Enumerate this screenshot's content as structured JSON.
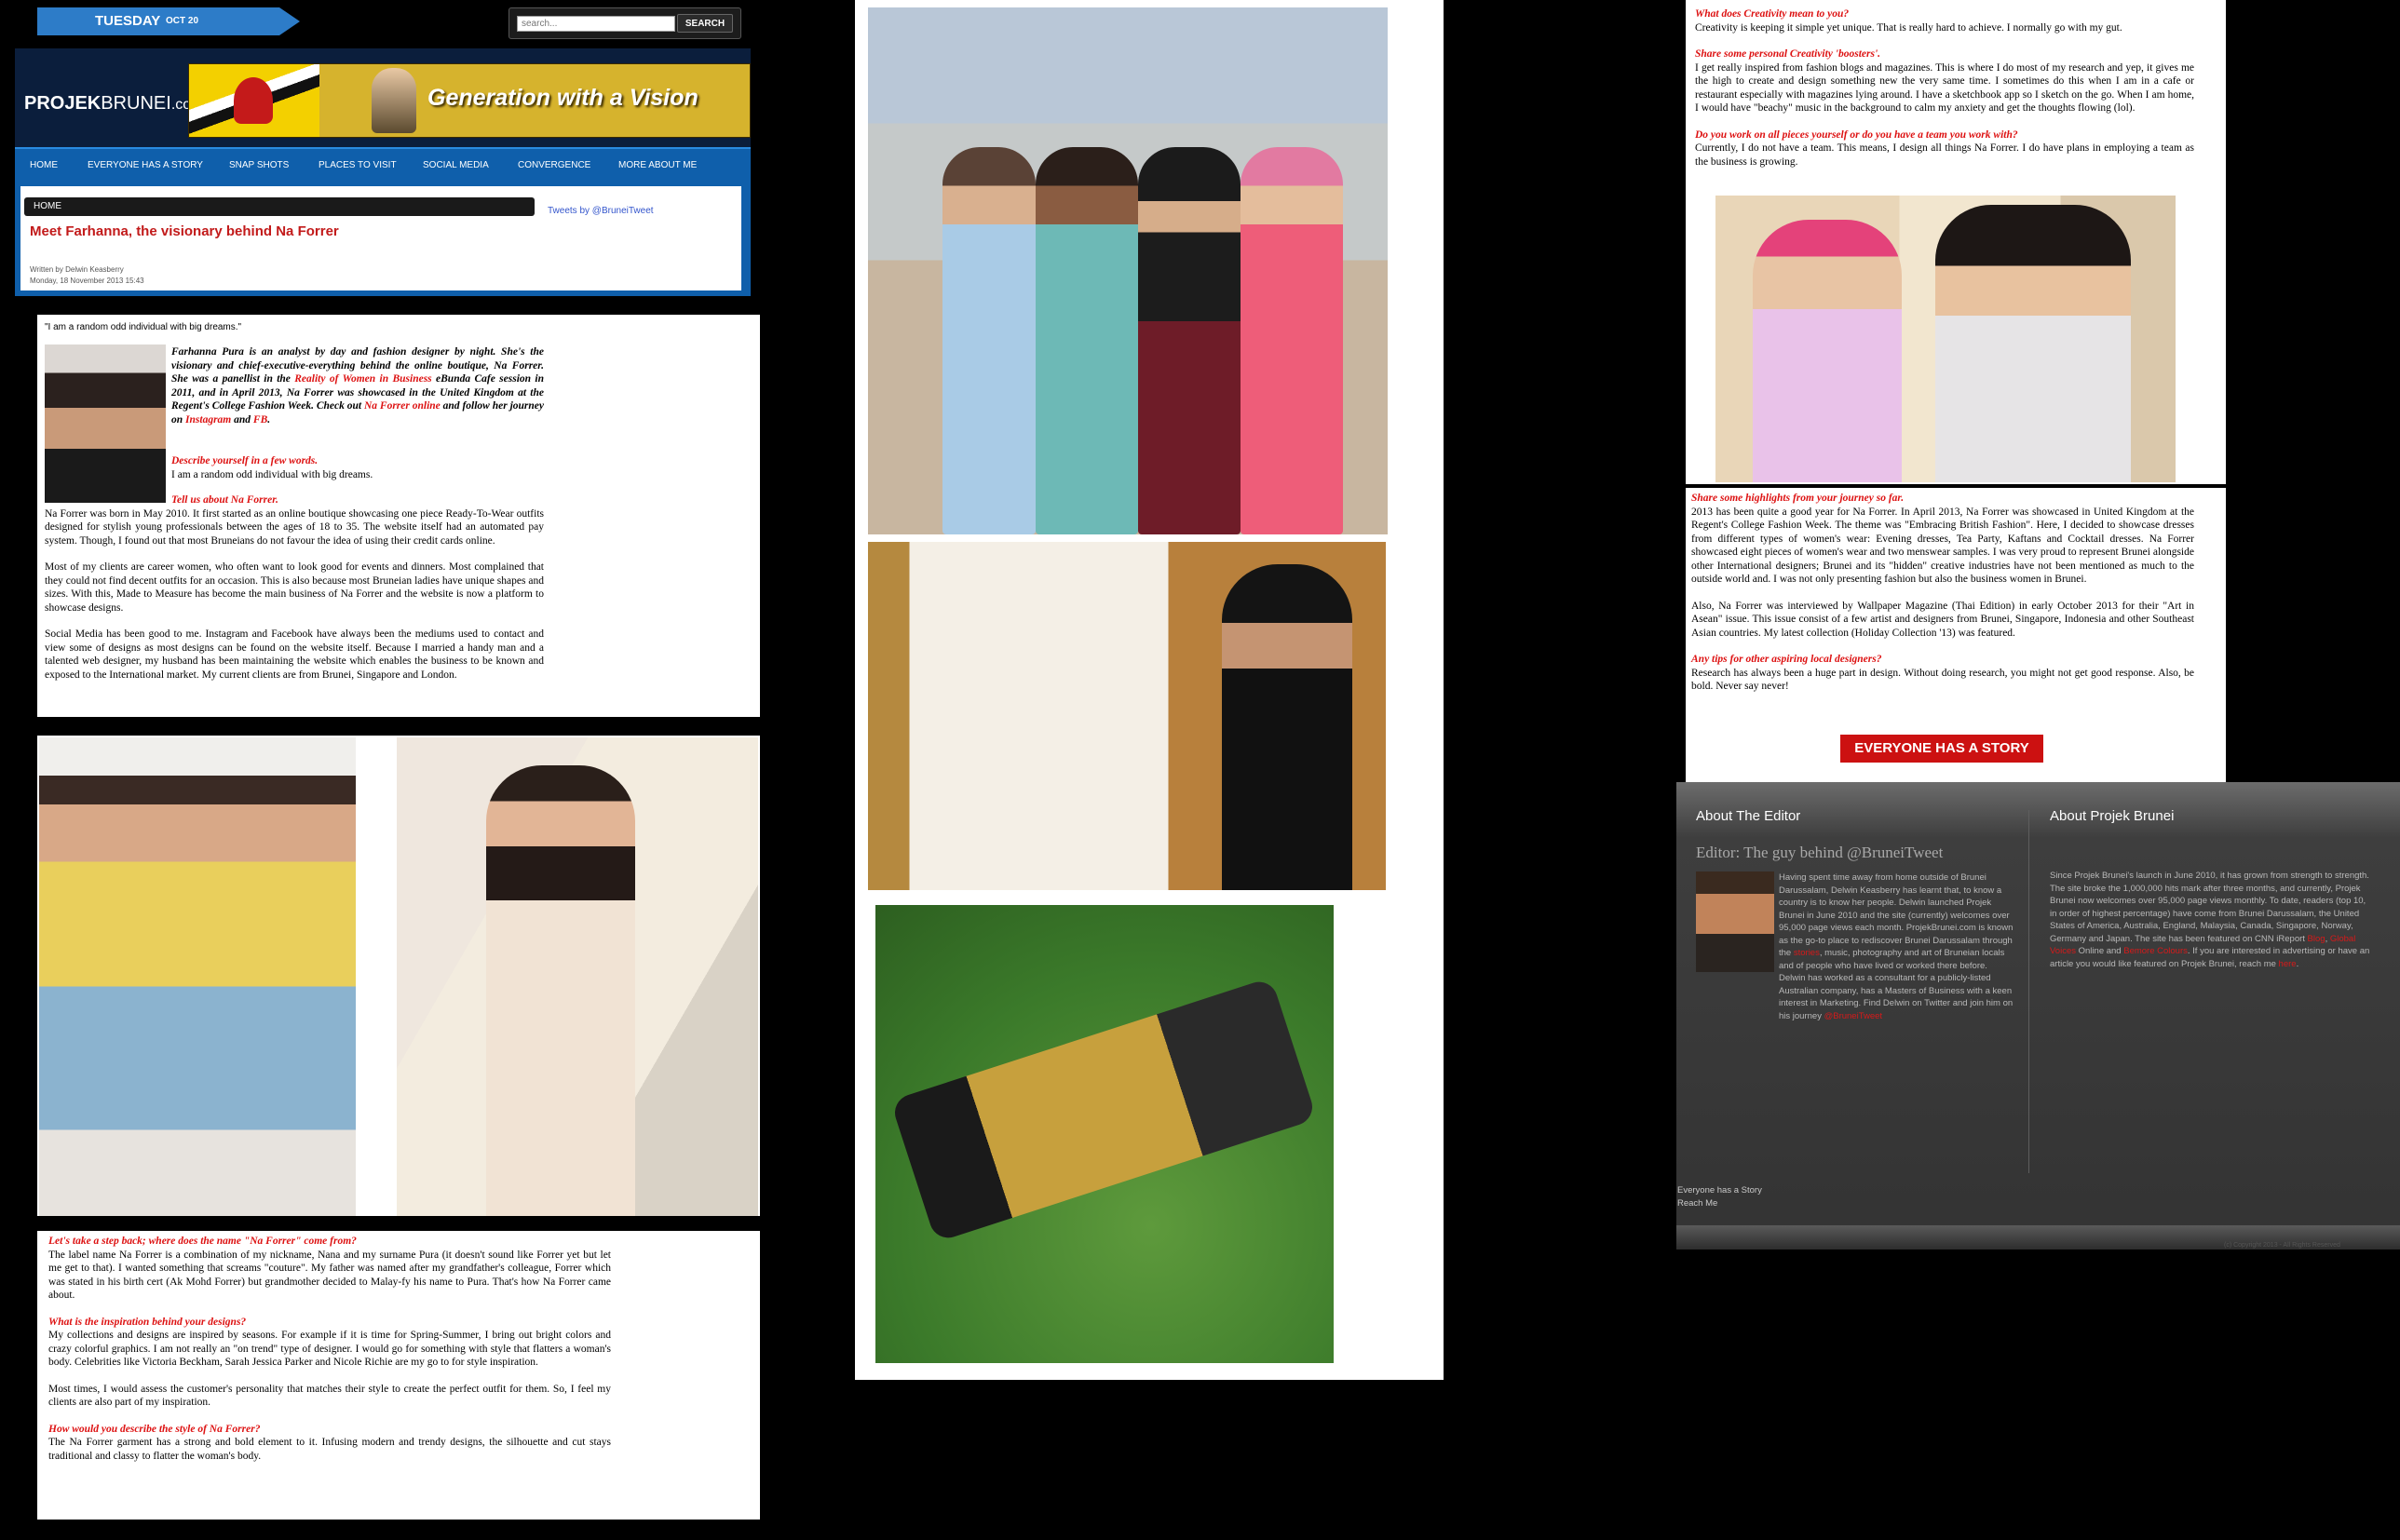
{
  "header": {
    "day": "TUESDAY",
    "date": "OCT 20",
    "search_placeholder": "search...",
    "search_button": "SEARCH",
    "logo_bold": "PROJEK",
    "logo_rest": "BRUNEI",
    "logo_tld": ".com",
    "banner_slogan": "Generation with a Vision"
  },
  "nav": {
    "items": [
      "HOME",
      "EVERYONE HAS A STORY",
      "SNAP SHOTS",
      "PLACES TO VISIT",
      "SOCIAL MEDIA",
      "CONVERGENCE",
      "MORE ABOUT ME"
    ]
  },
  "article": {
    "breadcrumb": "HOME",
    "tweets_link": "Tweets by @BruneiTweet",
    "title": "Meet Farhanna, the visionary behind Na Forrer",
    "author": "Written by Delwin Keasberry",
    "date": "Monday, 18 November 2013 15:43",
    "quote": "\"I am a random odd individual with big dreams.\"",
    "intro_1": "Farhanna Pura is an analyst by day and fashion designer by night. She's the visionary and chief-executive-everything behind the online boutique, Na Forrer. She was a panellist in the ",
    "intro_link_1": "Reality of Women in Business",
    "intro_2": " eBunda Cafe session in 2011, and in April 2013, Na Forrer was showcased in the United Kingdom at the Regent's College Fashion Week. Check out ",
    "intro_link_2": "Na Forrer online",
    "intro_3": " and follow her journey on ",
    "intro_link_3": "Instagram",
    "intro_4": " and ",
    "intro_link_4": "FB",
    "intro_5": ".",
    "q_describe": "Describe yourself in a few words.",
    "a_describe": "I am a random odd individual with big dreams.",
    "q_tell": "Tell us about Na Forrer.",
    "a_tell_1": "Na Forrer was born in May 2010. It first started as an online boutique showcasing one piece Ready-To-Wear outfits designed for stylish young professionals between the ages of 18 to 35. The website itself had an automated pay system. Though, I found out that most Bruneians do not favour the idea of using their credit cards online.",
    "a_tell_2": "Most of my clients are career women, who often want to look good for events and dinners. Most complained that they could not find decent outfits for an occasion. This is also because most Bruneian ladies have unique shapes and sizes. With this, Made to Measure has become the main business of Na Forrer and the website is now a platform to showcase designs.",
    "a_tell_3": "Social Media has been good to me. Instagram and Facebook have always been the mediums used to contact and view some of designs as most designs can be found on the website itself. Because I married a handy man and a talented web designer, my husband has been maintaining the website which enables the business to be known and exposed to the International market. My current clients are from Brunei, Singapore and London.",
    "q_name": "Let's take a step back; where does the name \"Na Forrer\" come from?",
    "a_name": "The label name Na Forrer is a combination of my nickname, Nana and my surname Pura (it doesn't sound like Forrer yet but let me get to that). I wanted something that screams \"couture\". My father was named after my grandfather's colleague, Forrer which was stated in his birth cert (Ak Mohd Forrer) but grandmother decided to Malay-fy his name to Pura. That's how Na Forrer came about.",
    "q_inspiration": "What is the inspiration behind your designs?",
    "a_inspiration_1": "My collections and designs are inspired by seasons. For example if it is time for Spring-Summer, I bring out bright colors and crazy colorful graphics. I am not really an \"on trend\" type of designer. I would go for something with style that flatters a woman's body. Celebrities like Victoria Beckham, Sarah Jessica Parker and Nicole Richie are my go to for style inspiration.",
    "a_inspiration_2": "Most times, I would assess the customer's personality that matches their style to create the perfect outfit for them. So, I feel my clients are also part of my inspiration.",
    "q_style": "How would you describe the style of Na Forrer?",
    "a_style": "The Na Forrer garment has a strong and bold element to it. Infusing modern and trendy designs, the silhouette and cut stays traditional and classy to flatter the woman's body.",
    "q_creativity": "What does Creativity mean to you?",
    "a_creativity": "Creativity is keeping it simple yet unique. That is really hard to achieve. I normally go with my gut.",
    "q_boosters": "Share some personal Creativity 'boosters'.",
    "a_boosters": "I get really inspired from fashion blogs and magazines. This is where I do most of my research and yep, it gives me the high to create and design something new the very same time. I sometimes do this when I am in a cafe or restaurant especially with magazines lying around. I have a sketchbook app so I sketch on the go. When I am home, I would have \"beachy\" music in the background to calm my anxiety and get the thoughts flowing (lol).",
    "q_team": "Do you work on all pieces yourself or do you have a team you work with?",
    "a_team": "Currently, I do not have a team. This means, I design all things Na Forrer. I do have plans in employing a team as the business is growing.",
    "q_highlights": "Share some highlights from your journey so far.",
    "a_highlights_1": "2013 has been quite a good year for Na Forrer. In April 2013, Na Forrer was showcased in United Kingdom at the Regent's College Fashion Week. The theme was \"Embracing British Fashion\". Here, I decided to showcase dresses from different types of women's wear: Evening dresses, Tea Party, Kaftans and Cocktail dresses. Na Forrer showcased eight pieces of women's wear and two menswear samples. I was very proud to represent Brunei alongside other International designers; Brunei and its \"hidden\" creative industries have not been mentioned as much to the outside world and. I was not only presenting fashion but also the business women in Brunei.",
    "a_highlights_2": "Also, Na Forrer was interviewed by Wallpaper Magazine (Thai Edition) in early October 2013 for their \"Art in Asean\" issue. This issue consist of a few artist and designers from Brunei, Singapore, Indonesia and other Southeast Asian countries. My latest collection (Holiday Collection '13) was featured.",
    "q_tips": "Any tips for other aspiring local designers?",
    "a_tips": "Research has always been a huge part in design. Without doing research, you might not get good response. Also, be bold. Never say never!",
    "story_button": "EVERYONE HAS A STORY"
  },
  "footer": {
    "about_editor_heading": "About The Editor",
    "about_projek_heading": "About Projek Brunei",
    "editor_title": "Editor: The guy behind @BruneiTweet",
    "editor_text_1": "Having spent time away from home outside of Brunei Darussalam, Delwin Keasberry has learnt that, to know a country is to know her people. Delwin launched Projek Brunei in June 2010 and the site (currently) welcomes over 95,000 page views each month. ProjekBrunei.com is known as the go-to place to rediscover Brunei Darussalam through the ",
    "editor_link_1": "stories",
    "editor_text_2": ", music, photography and art of Bruneian locals and of people who have lived or worked there before. Delwin has worked as a consultant for a publicly-listed Australian company, has a Masters of Business with a keen interest in Marketing. Find Delwin on Twitter and join him on his journey ",
    "editor_link_2": "@BruneiTweet",
    "about_text_1": "Since Projek Brunei's launch in June 2010, it has grown from strength to strength. The site broke the 1,000,000 hits mark after three months, and currently, Projek Brunei now welcomes over 95,000 page views monthly. To date, readers (top 10, in order of highest percentage) have come from Brunei Darussalam, the United States of America, Australia, England, Malaysia, Canada, Singapore, Norway, Germany and Japan. The site has been featured on CNN iReport ",
    "about_link_1": "Blog",
    "about_text_2": ", ",
    "about_link_2": "Global Voices",
    "about_text_3": " Online and ",
    "about_link_3": "Bemore Colours",
    "about_text_4": ". If you are interested in advertising or have an article you would like featured on Projek Brunei, reach me ",
    "about_link_4": "here",
    "about_text_5": ".",
    "link_story": "Everyone has a Story",
    "link_reach": "Reach Me",
    "copyright": "(c) Copyright 2013 - All Rights Reserved"
  },
  "colors": {
    "nav_blue": "#0f5fab",
    "accent_red": "#cc1111",
    "date_banner": "#2d7cc8"
  }
}
